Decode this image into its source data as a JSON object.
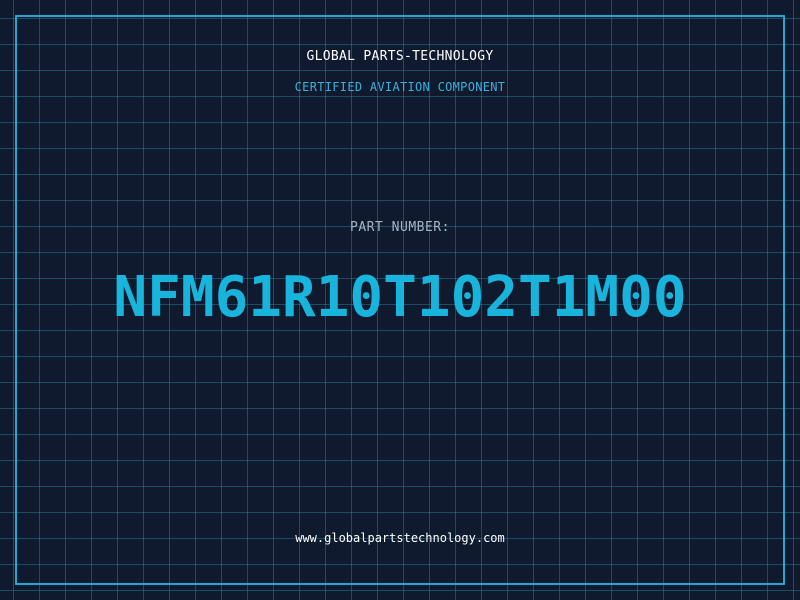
{
  "header": {
    "brand": "GLOBAL PARTS-TECHNOLOGY",
    "tagline": "CERTIFIED AVIATION COMPONENT"
  },
  "part": {
    "label": "PART NUMBER:",
    "number": "NFM61R10T102T1M00"
  },
  "footer": {
    "website": "www.globalpartstechnology.com"
  },
  "colors": {
    "background": "#101a2e",
    "accent": "#19b4dc",
    "grid": "#288caa",
    "frame": "#1fa8d0"
  }
}
